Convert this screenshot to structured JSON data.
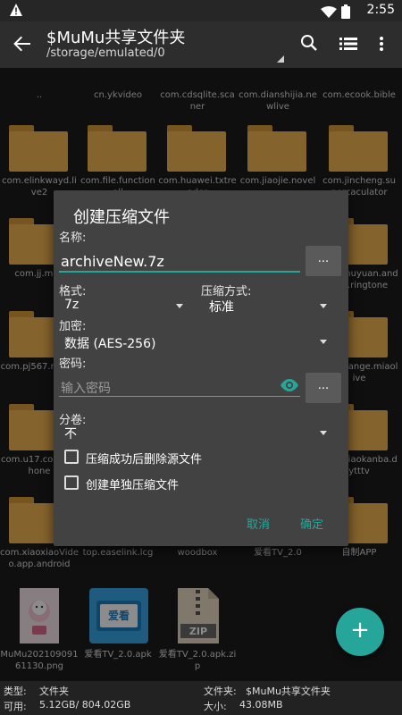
{
  "status": {
    "time": "2:55"
  },
  "appbar": {
    "title": "$MuMu共享文件夹",
    "path": "/storage/emulated/0"
  },
  "grid": {
    "row0": [
      "..",
      "cn.ykvideo",
      "com.cdsqlite.scaner",
      "com.dianshijia.newlive",
      "com.ecook.bible"
    ],
    "row1": [
      "com.elinkwayd.live2",
      "com.file.functionall",
      "com.huawei.txtreader",
      "com.jiaojie.novel",
      "com.jincheng.supercaculator"
    ],
    "row2": [
      "com.jj.mao",
      "",
      "",
      "",
      "com.muyuan.android.ringtone"
    ],
    "row3": [
      "com.pj567.movie",
      "",
      "",
      "",
      "com.tiange.miaolive"
    ],
    "row4": [
      "com.u17.comic.phone",
      "",
      "",
      "",
      "com.xiaokanba.dytttv"
    ],
    "row5": [
      "com.xiaoxiaoVideo.app.android",
      "top.easelink.lcg",
      "woodbox",
      "爱看TV_2.0",
      "自制APP"
    ],
    "row6": [
      "MuMu20210909161130.png",
      "爱看TV_2.0.apk",
      "爱看TV_2.0.apk.zip"
    ],
    "thumb_label": "爱看",
    "zip_label": "ZIP"
  },
  "dialog": {
    "title": "创建压缩文件",
    "name_label": "名称:",
    "name_value": "archiveNew.7z",
    "browse_label": "...",
    "format_label": "格式:",
    "format_value": "7z",
    "method_label": "压缩方式:",
    "method_value": "标准",
    "encrypt_label": "加密:",
    "encrypt_value": "数据 (AES-256)",
    "password_label": "密码:",
    "password_placeholder": "输入密码",
    "split_label": "分卷:",
    "split_value": "不",
    "delete_source_label": "压缩成功后删除源文件",
    "separate_label": "创建单独压缩文件",
    "cancel_label": "取消",
    "ok_label": "确定"
  },
  "info": {
    "type_label": "类型:",
    "type_value": "文件夹",
    "avail_label": "可用:",
    "avail_value": "5.12GB/ 804.02GB",
    "folder_label": "文件夹:",
    "folder_value": "$MuMu共享文件夹",
    "size_label": "大小:",
    "size_value": "43.08MB"
  },
  "colors": {
    "accent": "#26a69a",
    "folder": "#f2b450",
    "dialog_bg": "#424242"
  }
}
